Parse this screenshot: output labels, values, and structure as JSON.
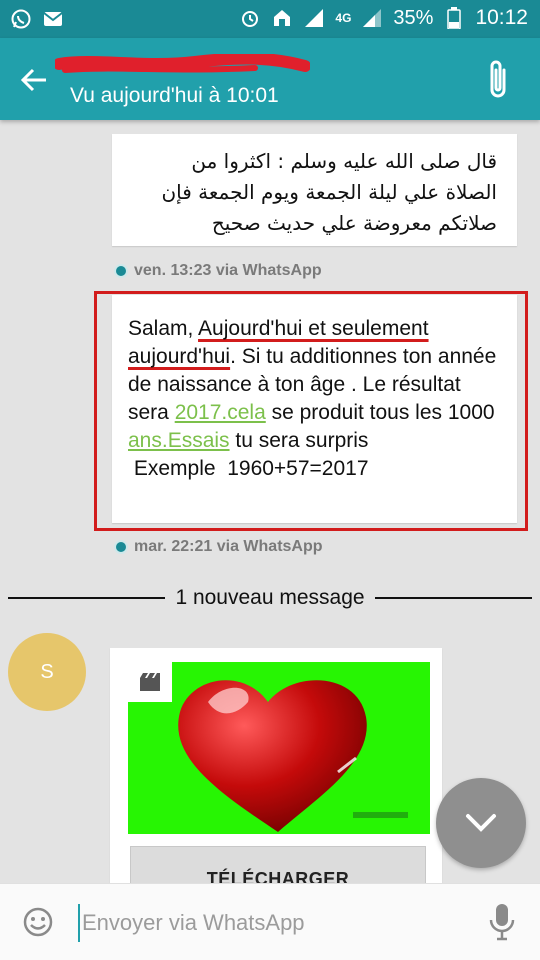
{
  "status_bar": {
    "network": "4G",
    "battery": "35%",
    "time": "10:12"
  },
  "header": {
    "contact_name": "",
    "last_seen": "Vu aujourd'hui à 10:01"
  },
  "messages": [
    {
      "direction": "incoming",
      "lines": [
        "قال صلى الله عليه وسلم : اكثروا من",
        "الصلاة علي ليلة الجمعة ويوم الجمعة فإن",
        "صلاتكم معروضة علي حديث صحيح"
      ],
      "meta": "ven. 13:23 via WhatsApp"
    },
    {
      "direction": "incoming",
      "parts": {
        "p1": "Salam, ",
        "p2": "Aujourd'hui et seulement aujourd'hui",
        "p3": ". Si tu additionnes ton année de naissance à ton âge . Le résultat sera ",
        "link1": "2017.cela",
        "p4": " se  produit tous les 1000 ",
        "link2": "ans.Essais",
        "p5": " tu sera surpris",
        "p6": " Exemple  1960+57=2017"
      },
      "meta": "mar. 22:21 via WhatsApp"
    }
  ],
  "divider": {
    "label": "1 nouveau message"
  },
  "media_message": {
    "avatar_letter": "S",
    "image_bg": "#27f503",
    "download_label": "TÉLÉCHARGER"
  },
  "composer": {
    "placeholder": "Envoyer via WhatsApp"
  },
  "colors": {
    "status_bar": "#1a8a95",
    "app_bar": "#21a0ab",
    "link": "#7cc04b",
    "annotation_red": "#d21c1c",
    "avatar": "#e6c66b"
  }
}
